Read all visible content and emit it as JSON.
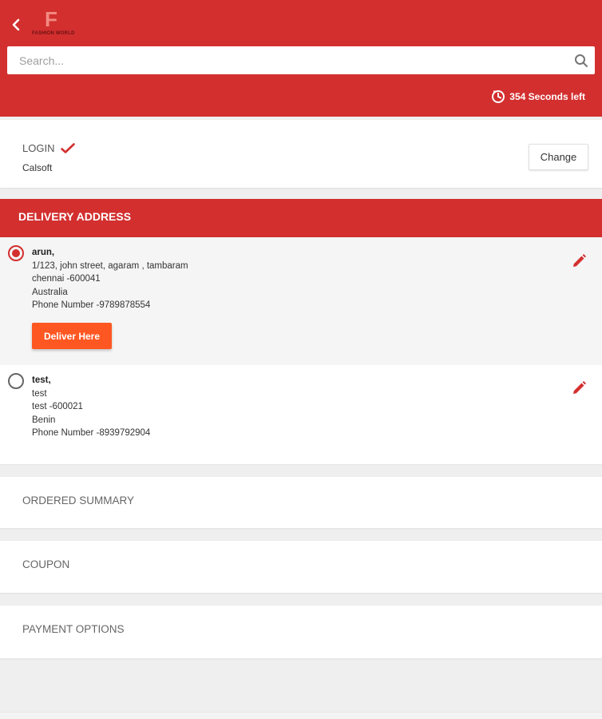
{
  "header": {
    "brand_letter": "F",
    "brand_name": "FASHION WORLD",
    "search_placeholder": "Search...",
    "timer_text": "354 Seconds left",
    "accent": "#d32f2f"
  },
  "login": {
    "title": "LOGIN",
    "user": "Calsoft",
    "change_label": "Change"
  },
  "delivery": {
    "title": "DELIVERY ADDRESS",
    "deliver_label": "Deliver Here",
    "addresses": [
      {
        "selected": true,
        "name": "arun,",
        "street": "1/123, john street, agaram , tambaram",
        "city": "chennai -600041",
        "country": "Australia",
        "phone": "Phone Number -9789878554"
      },
      {
        "selected": false,
        "name": "test,",
        "street": "test",
        "city": "test -600021",
        "country": "Benin",
        "phone": "Phone Number -8939792904"
      }
    ]
  },
  "sections": {
    "ordered_summary": "ORDERED SUMMARY",
    "coupon": "COUPON",
    "payment_options": "PAYMENT OPTIONS"
  },
  "icons": {
    "back": "back-arrow-icon",
    "search": "search-icon",
    "timer": "timer-icon",
    "check": "check-icon",
    "edit": "pencil-icon"
  }
}
